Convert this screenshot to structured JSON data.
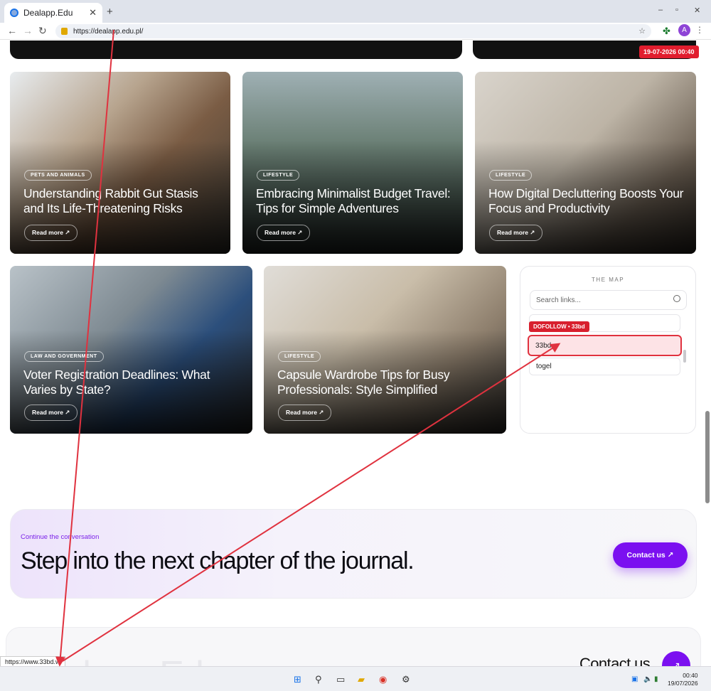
{
  "browser": {
    "tab_title": "Dealapp.Edu",
    "tab_close": "✕",
    "new_tab": "+",
    "url": "https://dealapp.edu.pl/",
    "win_min": "–",
    "win_max": "▫",
    "win_close": "✕",
    "avatar_letter": "A"
  },
  "date_flag": "19-07-2026 00:40",
  "cards": [
    {
      "category": "PETS AND ANIMALS",
      "title": "Understanding Rabbit Gut Stasis and Its Life-Threatening Risks",
      "read_more": "Read more ↗"
    },
    {
      "category": "LIFESTYLE",
      "title": "Embracing Minimalist Budget Travel: Tips for Simple Adventures",
      "read_more": "Read more ↗"
    },
    {
      "category": "LIFESTYLE",
      "title": "How Digital Decluttering Boosts Your Focus and Productivity",
      "read_more": "Read more ↗"
    },
    {
      "category": "LAW AND GOVERNMENT",
      "title": "Voter Registration Deadlines: What Varies by State?",
      "read_more": "Read more ↗"
    },
    {
      "category": "LIFESTYLE",
      "title": "Capsule Wardrobe Tips for Busy Professionals: Style Simplified",
      "read_more": "Read more ↗"
    }
  ],
  "map": {
    "heading": "THE MAP",
    "search_placeholder": "Search links...",
    "dofollow_badge": "DOFOLLOW • 33bd",
    "items": [
      "33bd",
      "togel"
    ]
  },
  "cta": {
    "kicker": "Continue the conversation",
    "headline": "Step into the next chapter of the journal.",
    "button": "Contact us ↗"
  },
  "footer": {
    "brand": "Dealapp.Edu",
    "contact": "Contact us",
    "button_icon": "↗"
  },
  "status_url": "https://www.33bd.w",
  "taskbar": {
    "time": "00:40",
    "date": "19/07/2026"
  },
  "colors": {
    "accent": "#7b10f0",
    "annotation_red": "#e0323f"
  }
}
